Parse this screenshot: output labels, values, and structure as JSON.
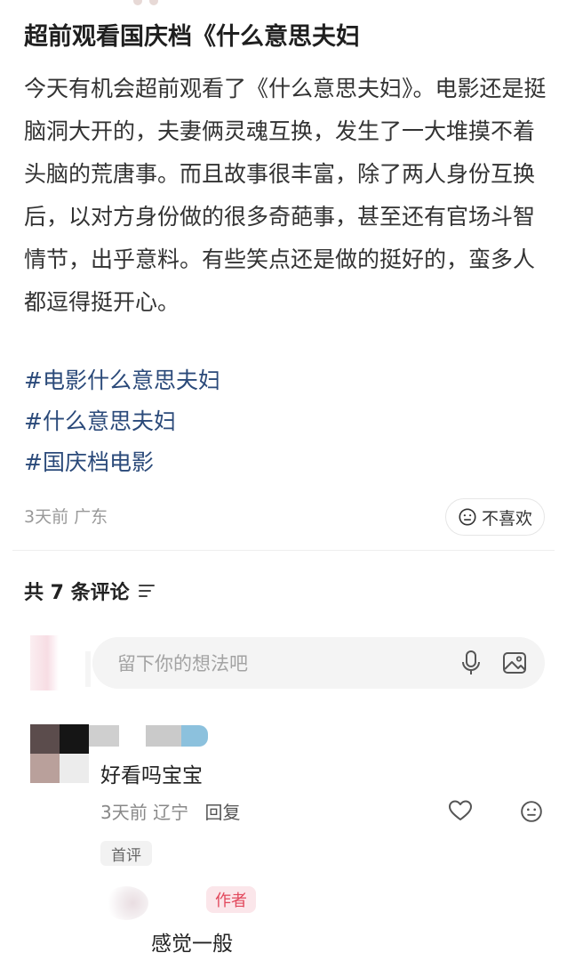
{
  "post": {
    "title": "超前观看国庆档《什么意思夫妇",
    "body": "今天有机会超前观看了《什么意思夫妇》。电影还是挺脑洞大开的，夫妻俩灵魂互换，发生了一大堆摸不着头脑的荒唐事。而且故事很丰富，除了两人身份互换后，以对方身份做的很多奇葩事，甚至还有官场斗智情节，出乎意料。有些笑点还是做的挺好的，蛮多人都逗得挺开心。",
    "tags": [
      "#电影什么意思夫妇",
      "#什么意思夫妇",
      "#国庆档电影"
    ],
    "meta": "3天前 广东",
    "dislike_label": "不喜欢",
    "icons": {
      "dislike": "neutral-face-icon"
    }
  },
  "comments_section": {
    "count_label": "共 7 条评论",
    "input_placeholder": "留下你的想法吧",
    "icons": {
      "sort": "sort-lines-icon",
      "voice": "microphone-icon",
      "image": "image-icon"
    },
    "comments": [
      {
        "text": "好看吗宝宝",
        "time": "3天前",
        "location": "辽宁",
        "reply_label": "回复",
        "badge": "首评",
        "icons": {
          "like": "heart-icon",
          "dislike": "neutral-face-icon"
        }
      },
      {
        "author_badge": "作者",
        "text": "感觉一般"
      }
    ]
  },
  "colors": {
    "tag_link": "#2b4a7a",
    "author_badge_text": "#e2485c",
    "author_badge_bg": "#fbe6ea"
  }
}
